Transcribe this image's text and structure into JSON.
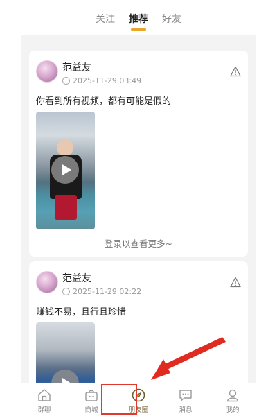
{
  "tabs": [
    {
      "label": "关注",
      "active": false
    },
    {
      "label": "推荐",
      "active": true
    },
    {
      "label": "好友",
      "active": false
    }
  ],
  "posts": [
    {
      "username": "范益友",
      "timestamp": "2025-11-29 03:49",
      "text": "你看到所有视频，都有可能是假的",
      "footer": "登录以查看更多~"
    },
    {
      "username": "范益友",
      "timestamp": "2025-11-29 02:22",
      "text": "赚钱不易，且行且珍惜"
    }
  ],
  "bottom_nav": [
    {
      "label": "群聊",
      "icon": "home-icon"
    },
    {
      "label": "商城",
      "icon": "shop-bag-icon"
    },
    {
      "label": "朋友圈",
      "icon": "compass-icon",
      "active": true
    },
    {
      "label": "消息",
      "icon": "chat-icon"
    },
    {
      "label": "我的",
      "icon": "profile-icon"
    }
  ],
  "colors": {
    "accent": "#e7a52a",
    "annotation_red": "#e03a2f"
  }
}
